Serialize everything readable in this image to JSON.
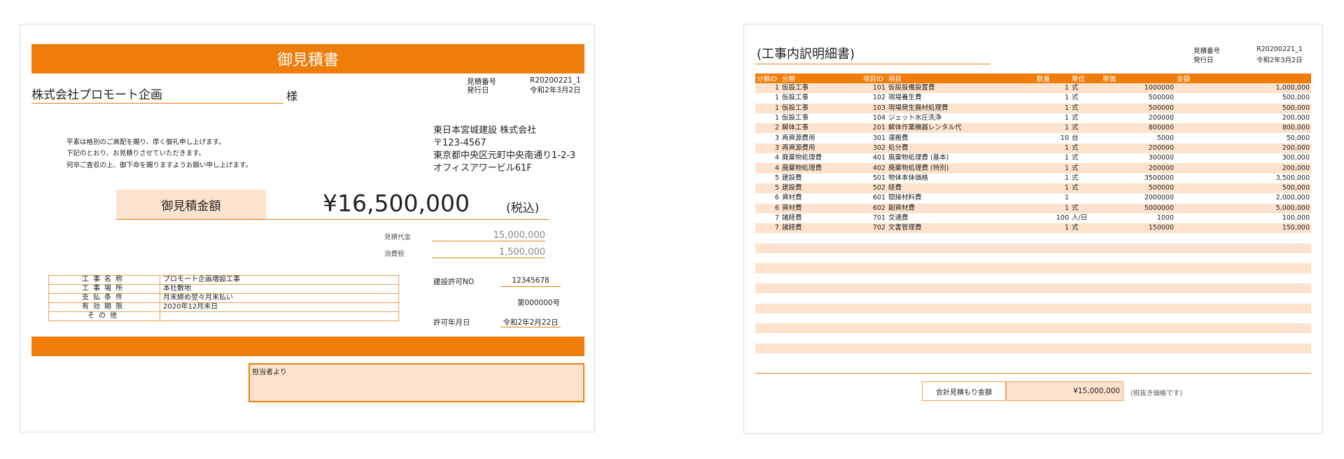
{
  "left": {
    "title": "御見積書",
    "quote_no_label": "見積番号",
    "quote_no": "R20200221_1",
    "issue_date_label": "発行日",
    "issue_date": "令和2年3月2日",
    "client_name": "株式会社プロモート企画",
    "honorific": "様",
    "greeting_lines": [
      "平素は格別のご高配を賜り、厚く御礼申し上げます。",
      "下記のとおり、お見積りさせていただきます。",
      "何卒ご査収の上、御下命を賜りますようお願い申し上げます。"
    ],
    "company": {
      "name": "東日本宮城建設 株式会社",
      "postal": "〒123-4567",
      "address1": "東京都中央区元町中央南通り1-2-3",
      "address2": "オフィスアワービル61F"
    },
    "amount_label": "御見積金額",
    "amount": "¥16,500,000",
    "tax_included": "(税込)",
    "subtotal_label": "見積代金",
    "subtotal": "15,000,000",
    "tax_label": "消費税",
    "tax": "1,500,000",
    "info_rows": [
      {
        "label": "工事名称",
        "value": "プロモート企画増設工事"
      },
      {
        "label": "工事場所",
        "value": "本社敷地"
      },
      {
        "label": "支払条件",
        "value": "月末締め翌々月末払い"
      },
      {
        "label": "有効期限",
        "value": "2020年12月末日"
      },
      {
        "label": "その他",
        "value": ""
      }
    ],
    "license_label": "建設許可NO",
    "license_no": "12345678",
    "license_no2": "第000000号",
    "license_date_label": "許可年月日",
    "license_date": "令和2年2月22日",
    "memo_label": "担当者より"
  },
  "right": {
    "title": "(工事内訳明細書)",
    "quote_no_label": "見積番号",
    "quote_no": "R20200221_1",
    "issue_date_label": "発行日",
    "issue_date": "令和2年3月2日",
    "headers": [
      "分類ID",
      "分類",
      "項目ID",
      "項目",
      "数量",
      "単位",
      "単価",
      "金額"
    ],
    "rows": [
      {
        "cat_id": "1",
        "cat": "仮設工事",
        "item_id": "101",
        "item": "仮設設備設置費",
        "qty": "1",
        "unit": "式",
        "price": "1000000",
        "amount": "1,000,000"
      },
      {
        "cat_id": "1",
        "cat": "仮設工事",
        "item_id": "102",
        "item": "現場養生費",
        "qty": "1",
        "unit": "式",
        "price": "500000",
        "amount": "500,000"
      },
      {
        "cat_id": "1",
        "cat": "仮設工事",
        "item_id": "103",
        "item": "現場発生廃材処理費",
        "qty": "1",
        "unit": "式",
        "price": "500000",
        "amount": "500,000"
      },
      {
        "cat_id": "1",
        "cat": "仮設工事",
        "item_id": "104",
        "item": "ジェット水圧洗浄",
        "qty": "1",
        "unit": "式",
        "price": "200000",
        "amount": "200,000"
      },
      {
        "cat_id": "2",
        "cat": "解体工事",
        "item_id": "201",
        "item": "解体作業機器レンタル代",
        "qty": "1",
        "unit": "式",
        "price": "800000",
        "amount": "800,000"
      },
      {
        "cat_id": "3",
        "cat": "再資源費用",
        "item_id": "301",
        "item": "運搬費",
        "qty": "10",
        "unit": "台",
        "price": "5000",
        "amount": "50,000"
      },
      {
        "cat_id": "3",
        "cat": "再資源費用",
        "item_id": "302",
        "item": "処分費",
        "qty": "1",
        "unit": "式",
        "price": "200000",
        "amount": "200,000"
      },
      {
        "cat_id": "4",
        "cat": "廃棄物処理費",
        "item_id": "401",
        "item": "廃棄物処理費 (基本)",
        "qty": "1",
        "unit": "式",
        "price": "300000",
        "amount": "300,000"
      },
      {
        "cat_id": "4",
        "cat": "廃棄物処理費",
        "item_id": "402",
        "item": "廃棄物処理費 (特別)",
        "qty": "1",
        "unit": "式",
        "price": "200000",
        "amount": "200,000"
      },
      {
        "cat_id": "5",
        "cat": "建設費",
        "item_id": "501",
        "item": "物体本体価格",
        "qty": "1",
        "unit": "式",
        "price": "3500000",
        "amount": "3,500,000"
      },
      {
        "cat_id": "5",
        "cat": "建設費",
        "item_id": "502",
        "item": "経費",
        "qty": "1",
        "unit": "式",
        "price": "500000",
        "amount": "500,000"
      },
      {
        "cat_id": "6",
        "cat": "資材費",
        "item_id": "601",
        "item": "間接材料費",
        "qty": "1",
        "unit": "",
        "price": "2000000",
        "amount": "2,000,000"
      },
      {
        "cat_id": "6",
        "cat": "資材費",
        "item_id": "602",
        "item": "副資材費",
        "qty": "1",
        "unit": "式",
        "price": "5000000",
        "amount": "5,000,000"
      },
      {
        "cat_id": "7",
        "cat": "諸経費",
        "item_id": "701",
        "item": "交通費",
        "qty": "100",
        "unit": "人/日",
        "price": "1000",
        "amount": "100,000"
      },
      {
        "cat_id": "7",
        "cat": "諸経費",
        "item_id": "702",
        "item": "文書管理費",
        "qty": "1",
        "unit": "式",
        "price": "150000",
        "amount": "150,000"
      }
    ],
    "total_label": "合計見積もり金額",
    "total": "¥15,000,000",
    "total_note": "(税抜き価格です)"
  },
  "colors": {
    "accent": "#f07d0a",
    "light": "#fde3cd"
  }
}
